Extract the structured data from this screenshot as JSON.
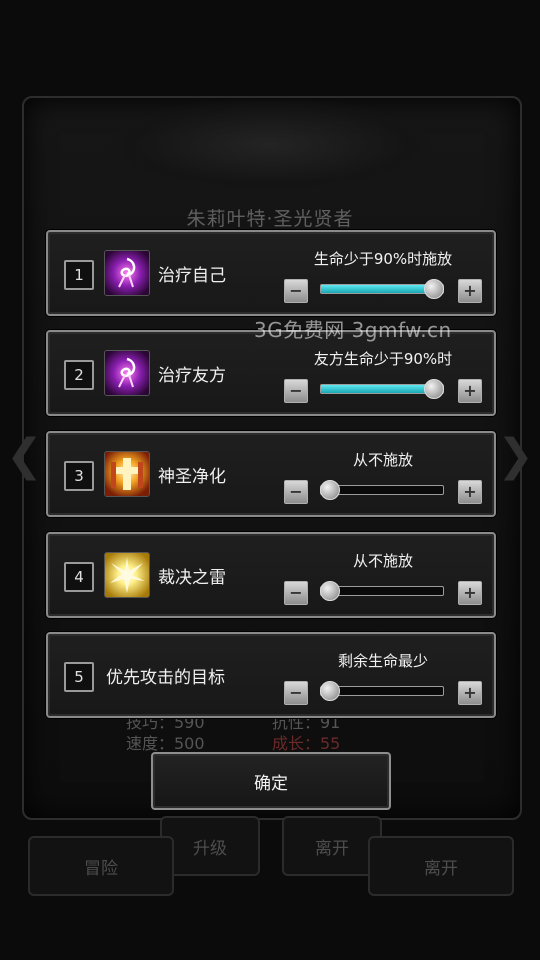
{
  "background": {
    "title": "朱莉叶特·圣光贤者",
    "stats_left": [
      "技巧：590",
      "速度：500"
    ],
    "stats_right": [
      "抗性：91",
      "成长：55"
    ],
    "buttons": [
      "升级",
      "离开",
      "冒险",
      "离开"
    ]
  },
  "watermark": "3G免费网  3gmfw.cn",
  "settings": [
    {
      "num": "1",
      "icon": "purple-spiral-icon",
      "name": "治疗自己",
      "condition": "生命少于90%时施放",
      "level": 0.92
    },
    {
      "num": "2",
      "icon": "purple-spiral-icon",
      "name": "治疗友方",
      "condition": "友方生命少于90%时",
      "level": 0.92
    },
    {
      "num": "3",
      "icon": "holy-cross-icon",
      "name": "神圣净化",
      "condition": "从不施放",
      "level": 0.0
    },
    {
      "num": "4",
      "icon": "lightning-burst-icon",
      "name": "裁决之雷",
      "condition": "从不施放",
      "level": 0.0
    },
    {
      "num": "5",
      "icon": "",
      "name": "优先攻击的目标",
      "condition": "剩余生命最少",
      "level": 0.0
    }
  ],
  "buttons": {
    "minus": "−",
    "plus": "+",
    "confirm": "确定"
  },
  "colors": {
    "slider_fill": "#2ec9d6",
    "panel_border": "#8a8a8a"
  }
}
